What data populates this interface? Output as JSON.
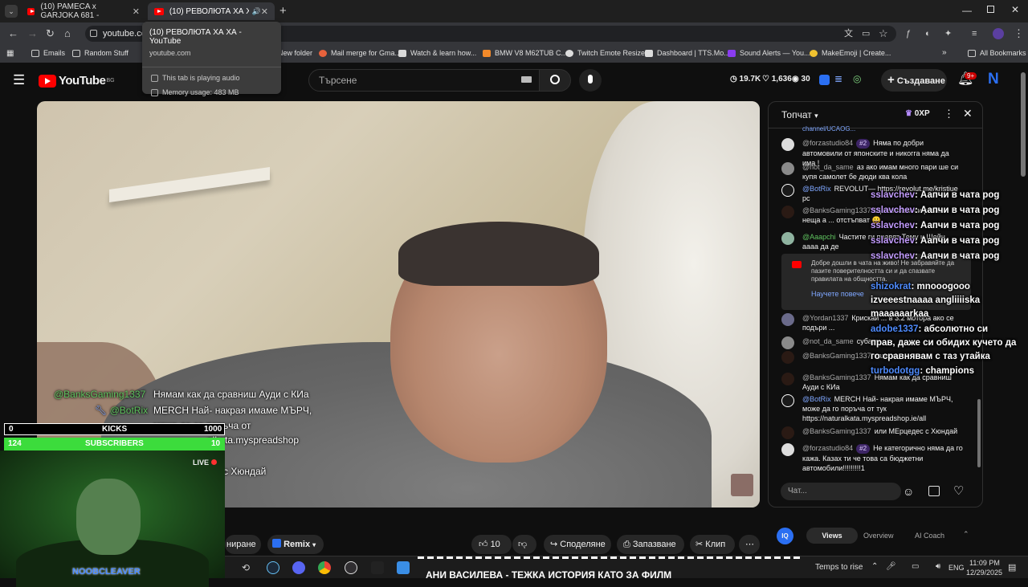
{
  "tabs": [
    {
      "title": "(10) PAMECA x GARJOKA 681 -"
    },
    {
      "title": "(10) РЕВОЛЮТА ХА ХА - Yo"
    }
  ],
  "omnibox": {
    "url": "youtube.com"
  },
  "tab_tooltip": {
    "title": "(10) РЕВОЛЮТА ХА ХА - YouTube",
    "domain": "youtube.com",
    "audio": "This tab is playing audio",
    "memory": "Memory usage: 483 MB"
  },
  "bookmarks": [
    "Emails",
    "Random Stuff",
    "New folder",
    "Mail merge for Gma...",
    "Watch & learn how...",
    "BMW V8 M62TUB C...",
    "Twitch Emote Resizer",
    "Dashboard | TTS.Mo...",
    "Sound Alerts — You...",
    "MakeEmoji | Create..."
  ],
  "all_bookmarks": "All Bookmarks",
  "yt": {
    "logo": "YouTube",
    "country": "BG",
    "search_placeholder": "Търсене",
    "stats": {
      "s1": "19.7K",
      "s2": "1,636",
      "s3": "30"
    },
    "create": "Създаване",
    "notif_count": "9+",
    "avatar_letter": "N"
  },
  "video_overlay": {
    "l1_user": "@BanksGaming1337",
    "l1_text": "Нямам как да сравниш Ауди с КИа",
    "l2_user": "@BotRix",
    "l2_text": "MERCH Най- накрая имаме МЪРЧ,",
    "l3_text": "може да се поръча от",
    "l4_text": "alkata.myspreadshop",
    "l5_text": "с Хюндай"
  },
  "kicks": {
    "label": "KICKS",
    "left": "0",
    "right": "1000"
  },
  "subs": {
    "label": "SUBSCRIBERS",
    "left": "124",
    "right": "10"
  },
  "cam": {
    "live": "LIVE",
    "name": "NOOBCLEAVER"
  },
  "chat": {
    "title": "Топчат",
    "xp": "0XP",
    "top_fragment": "channel/UCAOG...",
    "messages": [
      {
        "author": "@forzastudio84",
        "badge": "#2",
        "text": "Няма по добри автомовили от японските и никогга няма да има !"
      },
      {
        "author": "@not_da_same",
        "badge": "",
        "text": "аз ако имам много пари ше си купя самолет бе дюди ква кола"
      },
      {
        "author": "@BotRix",
        "badge": "",
        "text": "REVOLUT— https://revolut.me/kristiue pc"
      },
      {
        "author": "@BanksGaming1337",
        "badge": "",
        "text": "Ще вземем си разни неща а ... отстъпват 😀"
      },
      {
        "author": "@Aaapchi",
        "badge": "",
        "text": "Частите ги правят Тему и Шейн аааа да де"
      },
      {
        "author": "@Yordan1337",
        "badge": "",
        "text": "Крискай ... в 3.2 мотора ако се подъри ..."
      },
      {
        "author": "@not_da_same",
        "badge": "",
        "text": "субару ..."
      },
      {
        "author": "@BanksGaming1337",
        "badge": "",
        "text": "казвам ..."
      },
      {
        "author": "@BanksGaming1337",
        "badge": "",
        "text": "Нямам как да сравниш Ауди с КИа"
      },
      {
        "author": "@BotRix",
        "badge": "",
        "text": "MERCH Най- накрая имаме МЪРЧ, може да го поръча от тук https://naturalkata.myspreadshop.ie/all"
      },
      {
        "author": "@BanksGaming1337",
        "badge": "",
        "text": "или МЕрцедес с Хюндай"
      },
      {
        "author": "@forzastudio84",
        "badge": "#2",
        "text": "Не категорично няма да го кажа. Казах ти че това са бюджетни автомобили!!!!!!!!!1"
      }
    ],
    "welcome": {
      "text": "Добре дошли в чата на живо! Не забравяйте да пазите поверителността си и да спазвате правилата на общността.",
      "link": "Научете повече"
    },
    "input_placeholder": "Чат..."
  },
  "overlay_chat": [
    {
      "user": "sslavchev",
      "text": ": Аапчи в чата pog"
    },
    {
      "user": "sslavchev",
      "text": ": Аапчи в чата pog"
    },
    {
      "user": "sslavchev",
      "text": ": Аапчи в чата pog"
    },
    {
      "user": "sslavchev",
      "text": ": Аапчи в чата pog"
    },
    {
      "user": "sslavchev",
      "text": ": Аапчи в чата pog"
    },
    {
      "user": "shizokrat",
      "text": ": mnooogooo"
    },
    {
      "user": "",
      "text": "izveeestnaaaa angliiiiska"
    },
    {
      "user": "",
      "text": "maaaaaarkaa"
    },
    {
      "user": "adobe1337",
      "text": ": абсолютно си"
    },
    {
      "user": "",
      "text": "прав, даже си обидих кучето да"
    },
    {
      "user": "",
      "text": "го сравнявам с таз утайка"
    },
    {
      "user": "turbodotgg",
      "text": ": champions"
    }
  ],
  "actions": {
    "likes": "10",
    "share": "Споделяне",
    "save": "Запазване",
    "clip": "Клип",
    "remix": "Remix",
    "subscribe_frag": "ниране"
  },
  "vidiq": {
    "views": "Views",
    "overview": "Overview",
    "ai": "AI Coach"
  },
  "ticker": "АНИ ВАСИЛЕВА - ТЕЖКА ИСТОРИЯ КАТО ЗА ФИЛМ",
  "taskbar": {
    "weather": "Temps to rise",
    "lang": "ENG",
    "time": "11:09 PM",
    "date": "12/29/2025"
  },
  "colors": {
    "accent": "#ff0000",
    "subs_bar": "#3cdc3c",
    "chat_bg": "#0f0f0f"
  }
}
